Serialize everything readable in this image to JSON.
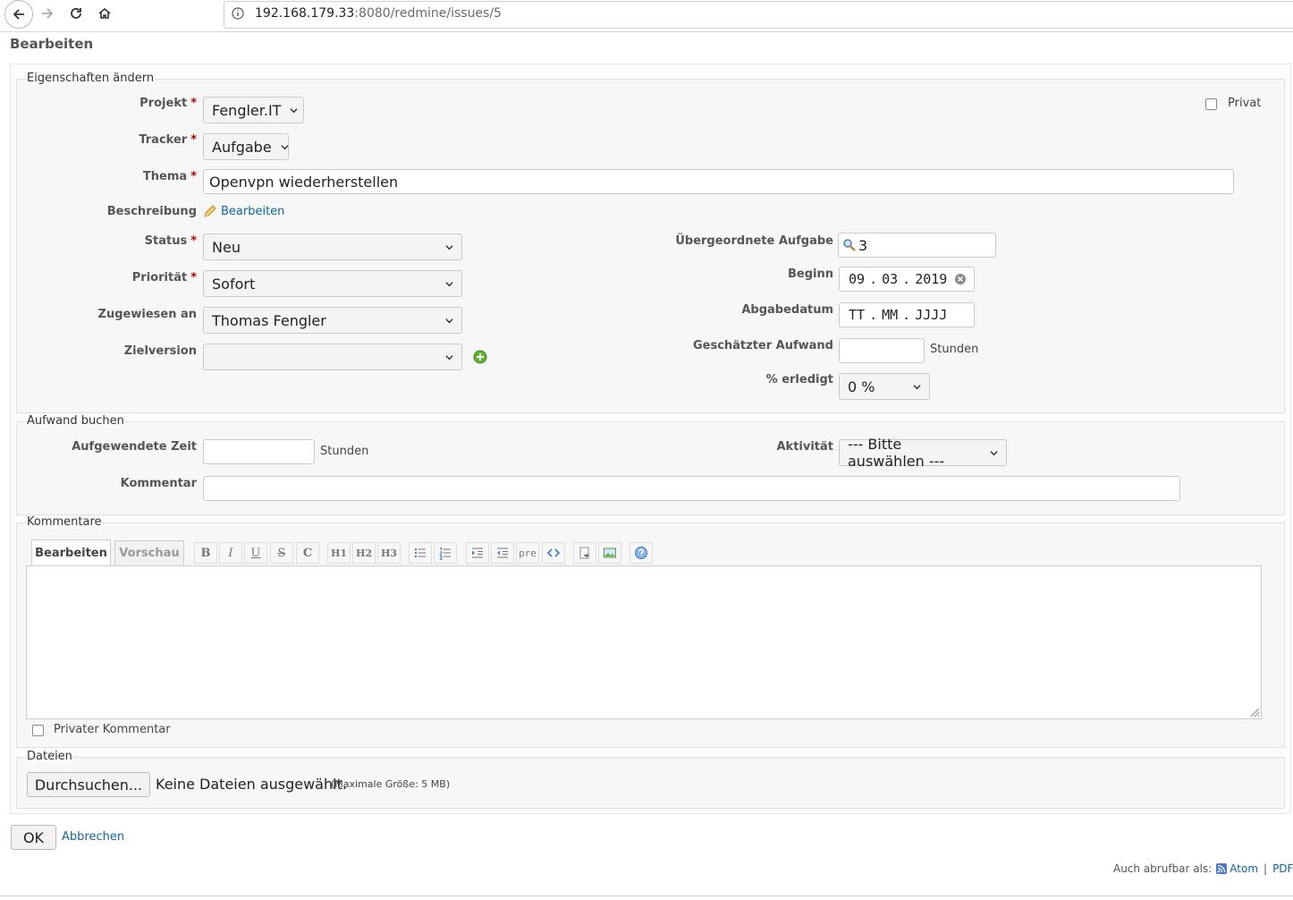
{
  "browser": {
    "url_host": "192.168.179.33",
    "url_rest": ":8080/redmine/issues/5"
  },
  "page_title": "Bearbeiten",
  "properties": {
    "legend": "Eigenschaften ändern",
    "projekt": {
      "label": "Projekt",
      "value": "Fengler.IT"
    },
    "privat": {
      "label": "Privat",
      "checked": false
    },
    "tracker": {
      "label": "Tracker",
      "value": "Aufgabe"
    },
    "thema": {
      "label": "Thema",
      "value": "Openvpn wiederherstellen"
    },
    "beschreibung": {
      "label": "Beschreibung",
      "link": "Bearbeiten"
    },
    "status": {
      "label": "Status",
      "value": "Neu"
    },
    "prioritaet": {
      "label": "Priorität",
      "value": "Sofort"
    },
    "zugewiesen": {
      "label": "Zugewiesen an",
      "value": "Thomas Fengler"
    },
    "zielversion": {
      "label": "Zielversion",
      "value": ""
    },
    "parent": {
      "label": "Übergeordnete Aufgabe",
      "value": "3"
    },
    "beginn": {
      "label": "Beginn",
      "day": "09",
      "month": "03",
      "year": "2019"
    },
    "abgabedatum": {
      "label": "Abgabedatum",
      "day": "TT",
      "month": "MM",
      "year": "JJJJ"
    },
    "aufwand": {
      "label": "Geschätzter Aufwand",
      "value": "",
      "unit": "Stunden"
    },
    "erledigt": {
      "label": "% erledigt",
      "value": "0 %"
    }
  },
  "time_entry": {
    "legend": "Aufwand buchen",
    "zeit": {
      "label": "Aufgewendete Zeit",
      "value": "",
      "unit": "Stunden"
    },
    "aktivitaet": {
      "label": "Aktivität",
      "value": "--- Bitte auswählen ---"
    },
    "kommentar": {
      "label": "Kommentar",
      "value": ""
    }
  },
  "notes": {
    "legend": "Kommentare",
    "tabs": [
      "Bearbeiten",
      "Vorschau"
    ],
    "toolbar": {
      "bold": "B",
      "italic": "I",
      "underline": "U",
      "strike": "S",
      "code": "C",
      "h1": "H1",
      "h2": "H2",
      "h3": "H3",
      "pre": "pre"
    },
    "text": "",
    "private_label": "Privater Kommentar"
  },
  "files": {
    "legend": "Dateien",
    "browse": "Durchsuchen...",
    "none": "Keine Dateien ausgewählt.",
    "max": "(Maximale Größe: 5 MB)"
  },
  "actions": {
    "ok": "OK",
    "cancel": "Abbrechen"
  },
  "footer": {
    "label": "Auch abrufbar als:",
    "atom": "Atom",
    "sep": "|",
    "pdf": "PDF"
  },
  "colors": {
    "required": "#bb0000",
    "link": "#116699",
    "add_icon": "#5fb336"
  }
}
